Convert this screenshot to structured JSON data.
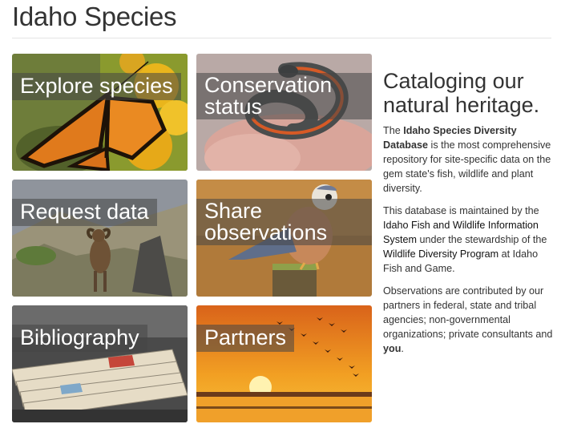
{
  "page": {
    "title": "Idaho Species"
  },
  "tiles": [
    {
      "label": "Explore species",
      "image": "monarch butterfly on yellow flowers"
    },
    {
      "label": "Conservation status",
      "image": "ringneck snake in hand"
    },
    {
      "label": "Request data",
      "image": "bighorn sheep on rocky slope"
    },
    {
      "label": "Share observations",
      "image": "kestrel perched on post"
    },
    {
      "label": "Bibliography",
      "image": "open file cabinet drawer"
    },
    {
      "label": "Partners",
      "image": "sunset over water with flying geese"
    }
  ],
  "sidebar": {
    "heading": "Cataloging our natural heritage.",
    "p1": {
      "pre": "The ",
      "bold": "Idaho Species Diversity Database",
      "post": " is the most comprehensive repository for site-specific data on the gem state's fish, wildlife and plant diversity."
    },
    "p2": {
      "pre": "This database is maintained by the ",
      "link1": "Idaho Fish and Wildlife Information System",
      "mid": " under the stewardship of the ",
      "link2": "Wildlife Diversity Program",
      "post": " at Idaho Fish and Game."
    },
    "p3": {
      "pre": "Observations are contributed by our partners in federal, state and tribal agencies; non-governmental organizations; private consultants and ",
      "bold": "you",
      "post": "."
    }
  }
}
